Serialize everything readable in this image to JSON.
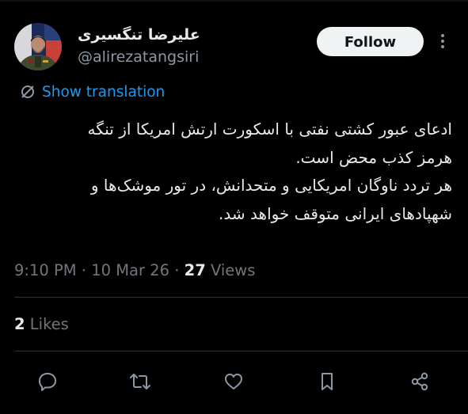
{
  "author": {
    "display_name": "علیرضا تنگسیری",
    "handle": "@alirezatangsiri",
    "avatar_icon": "profile-photo"
  },
  "follow_label": "Follow",
  "more_icon": "more-dots-icon",
  "translation": {
    "icon": "translate-icon",
    "label": "Show translation"
  },
  "tweet": {
    "lines": [
      "ادعای عبور کشتی نفتی با اسکورت ارتش امریکا از تنگه",
      "هرمز کذب محض است.",
      "هر تردد ناوگان امریکایی و متحدانش، در تور موشک‌ها و",
      "شهپادهای ایرانی متوقف خواهد شد."
    ]
  },
  "meta": {
    "time": "9:10 PM",
    "date": "10 Mar 26",
    "separator": "·",
    "views_count": "27",
    "views_label": "Views"
  },
  "likes": {
    "count": "2",
    "label": "Likes"
  },
  "actions": [
    "reply-icon",
    "retweet-icon",
    "like-icon",
    "bookmark-icon",
    "share-icon"
  ],
  "colors": {
    "background": "#000000",
    "text": "#e7e9ea",
    "secondary": "#71767b",
    "accent": "#1d9bf0",
    "divider": "#2f3336",
    "button_bg": "#eff3f4"
  }
}
